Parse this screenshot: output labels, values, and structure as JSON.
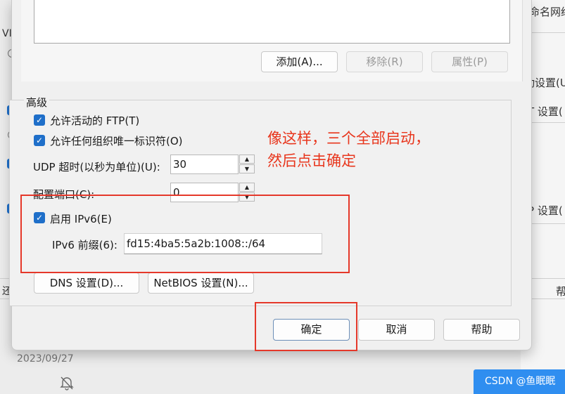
{
  "background": {
    "right_labels": [
      "命名网络",
      "动设置(U",
      "T 设置(",
      "P 设置(",
      "帮"
    ],
    "left_labels": [
      "VI",
      "还"
    ],
    "date": "2023/09/27",
    "bell_icon": "bell-off-icon"
  },
  "dialog": {
    "list_buttons": {
      "add": "添加(A)...",
      "remove": "移除(R)",
      "properties": "属性(P)"
    },
    "advanced": {
      "title": "高级",
      "allow_active_ftp": "允许活动的 FTP(T)",
      "allow_any_org_id": "允许任何组织唯一标识符(O)",
      "udp_timeout_label": "UDP 超时(以秒为单位)(U):",
      "udp_timeout_value": "30",
      "port_config_label": "配置端口(C):",
      "port_config_value": "0",
      "enable_ipv6": "启用 IPv6(E)",
      "ipv6_prefix_label": "IPv6 前缀(6):",
      "ipv6_prefix_value": "fd15:4ba5:5a2b:1008::/64",
      "dns_button": "DNS 设置(D)...",
      "netbios_button": "NetBIOS 设置(N)..."
    },
    "footer": {
      "ok": "确定",
      "cancel": "取消",
      "help": "帮助"
    }
  },
  "annotation": {
    "text": "像这样，三个全部启动，\n然后点击确定",
    "color": "#e8361d"
  },
  "watermark": "CSDN @鱼眠眠"
}
